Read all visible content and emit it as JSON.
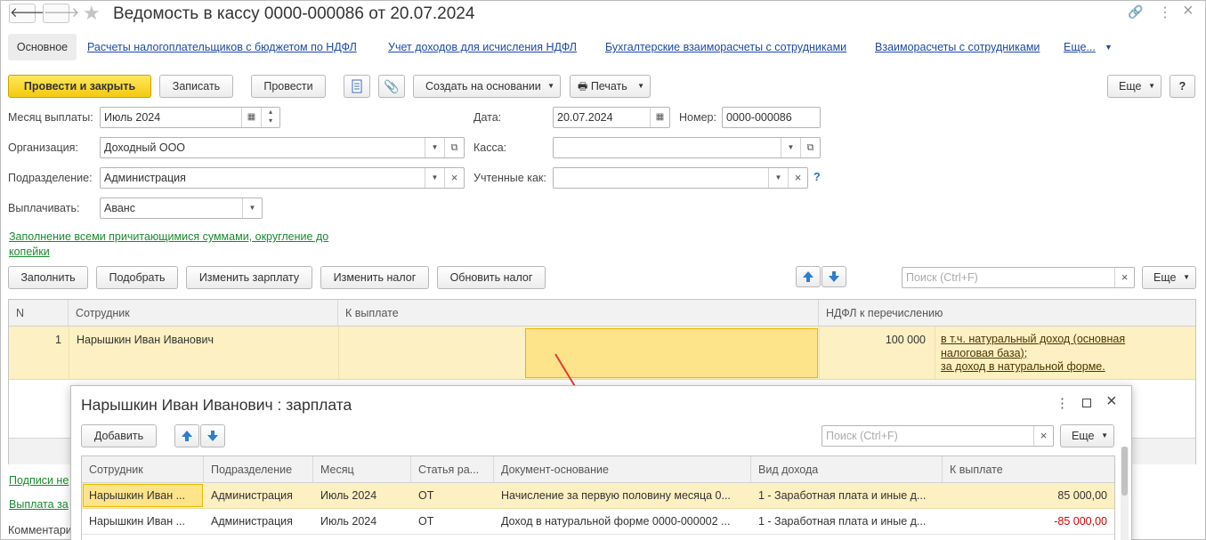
{
  "window": {
    "title": "Ведомость в кассу 0000-000086 от 20.07.2024"
  },
  "nav": {
    "back": "🡐",
    "forward": "🡒",
    "star": "★"
  },
  "titlebar_icons": {
    "link": "🔗",
    "menu": "⋮",
    "close": "×"
  },
  "tabs": [
    "Основное",
    "Расчеты налогоплательщиков с бюджетом по НДФЛ",
    "Учет доходов для исчисления НДФЛ",
    "Бухгалтерские взаиморасчеты с сотрудниками",
    "Взаиморасчеты с сотрудниками",
    "Еще..."
  ],
  "toolbar": {
    "post_close": "Провести и закрыть",
    "save": "Записать",
    "post": "Провести",
    "create_based": "Создать на основании",
    "print": "Печать",
    "more": "Еще",
    "help": "?"
  },
  "form": {
    "month_label": "Месяц выплаты:",
    "month_value": "Июль 2024",
    "date_label": "Дата:",
    "date_value": "20.07.2024",
    "number_label": "Номер:",
    "number_value": "0000-000086",
    "org_label": "Организация:",
    "org_value": "Доходный ООО",
    "cash_label": "Касса:",
    "cash_value": "",
    "dept_label": "Подразделение:",
    "dept_value": "Администрация",
    "counted_label": "Учтенные как:",
    "counted_value": "",
    "counted_help": "?",
    "pay_label": "Выплачивать:",
    "pay_value": "Аванс",
    "fill_link_line1": "Заполнение всеми причитающимися суммами, округление до",
    "fill_link_line2": "копейки"
  },
  "table_toolbar": {
    "fill": "Заполнить",
    "select": "Подобрать",
    "change_salary": "Изменить зарплату",
    "change_tax": "Изменить налог",
    "update_tax": "Обновить налог",
    "search_placeholder": "Поиск (Ctrl+F)",
    "more": "Еще"
  },
  "table": {
    "headers": [
      "N",
      "Сотрудник",
      "К выплате",
      "НДФЛ к перечислению"
    ],
    "rows": [
      {
        "n": "1",
        "employee": "Нарышкин Иван Иванович",
        "to_pay": "",
        "ndfl": "100 000",
        "note_line1": "в т.ч. натуральный доход (основная",
        "note_line2": "налоговая база);",
        "note_line3": "за доход в натуральной форме."
      }
    ]
  },
  "bottom_links": {
    "signatures": "Подписи не",
    "payment": "Выплата за",
    "comment": "Комментари"
  },
  "popup": {
    "title": "Нарышкин Иван Иванович : зарплата",
    "add": "Добавить",
    "search_placeholder": "Поиск (Ctrl+F)",
    "more": "Еще",
    "headers": [
      "Сотрудник",
      "Подразделение",
      "Месяц",
      "Статья ра...",
      "Документ-основание",
      "Вид дохода",
      "К выплате"
    ],
    "rows": [
      {
        "employee": "Нарышкин Иван ...",
        "dept": "Администрация",
        "month": "Июль 2024",
        "article": "ОТ",
        "doc": "Начисление за первую половину месяца 0...",
        "income": "1 - Заработная плата и иные д...",
        "amount": "85 000,00"
      },
      {
        "employee": "Нарышкин Иван ...",
        "dept": "Администрация",
        "month": "Июль 2024",
        "article": "ОТ",
        "doc": "Доход в натуральной форме 0000-000002 ...",
        "income": "1 - Заработная плата и иные д...",
        "amount": "-85 000,00"
      }
    ]
  },
  "colors": {
    "accent_yellow": "#f4c910",
    "link_blue": "#1d4aa8",
    "link_green": "#1a8a2e",
    "row_highlight": "#fdf0c2",
    "negative": "#d40000",
    "arrow_red": "#e53935"
  }
}
